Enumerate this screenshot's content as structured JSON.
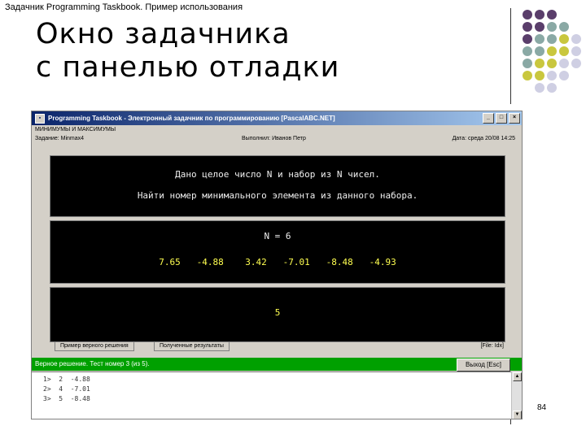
{
  "slide": {
    "header": "Задачник Programming Taskbook. Пример использования",
    "title_line1": "Окно задачника",
    "title_line2": "с панелью отладки",
    "page_number": "84",
    "colors": {
      "purple": "#5a3e6b",
      "teal": "#8aa9a5",
      "olive": "#c9c73e",
      "lilac": "#cfcfe3"
    }
  },
  "window": {
    "title": "Programming Taskbook - Электронный задачник по программированию [PascalABC.NET]",
    "controls": [
      "_",
      "□",
      "×"
    ],
    "group": "МИНИМУМЫ И МАКСИМУМЫ",
    "task": "Задание: Minmax4",
    "author": "Выполнил: Иванов Петр",
    "date": "Дата: среда 20/08 14:25"
  },
  "task_panel": {
    "line1": "Дано целое число N и набор из N чисел.",
    "line2": "Найти номер минимального элемента из данного набора."
  },
  "input_panel": {
    "n_label": "N = 6",
    "numbers": "7.65   -4.88    3.42   -7.01   -8.48   -4.93"
  },
  "output_panel": {
    "result": "5"
  },
  "tabs": {
    "tab1": "Пример верного решения",
    "tab2": "Полученные результаты",
    "right_label": "[File: Idx]"
  },
  "status": {
    "text": "Верное решение. Тест номер 3 (из 5).",
    "exit_label": "Выход [Esc]"
  },
  "debug": {
    "lines": [
      "1>  2  -4.88",
      "2>  4  -7.01",
      "3>  5  -8.48"
    ]
  }
}
